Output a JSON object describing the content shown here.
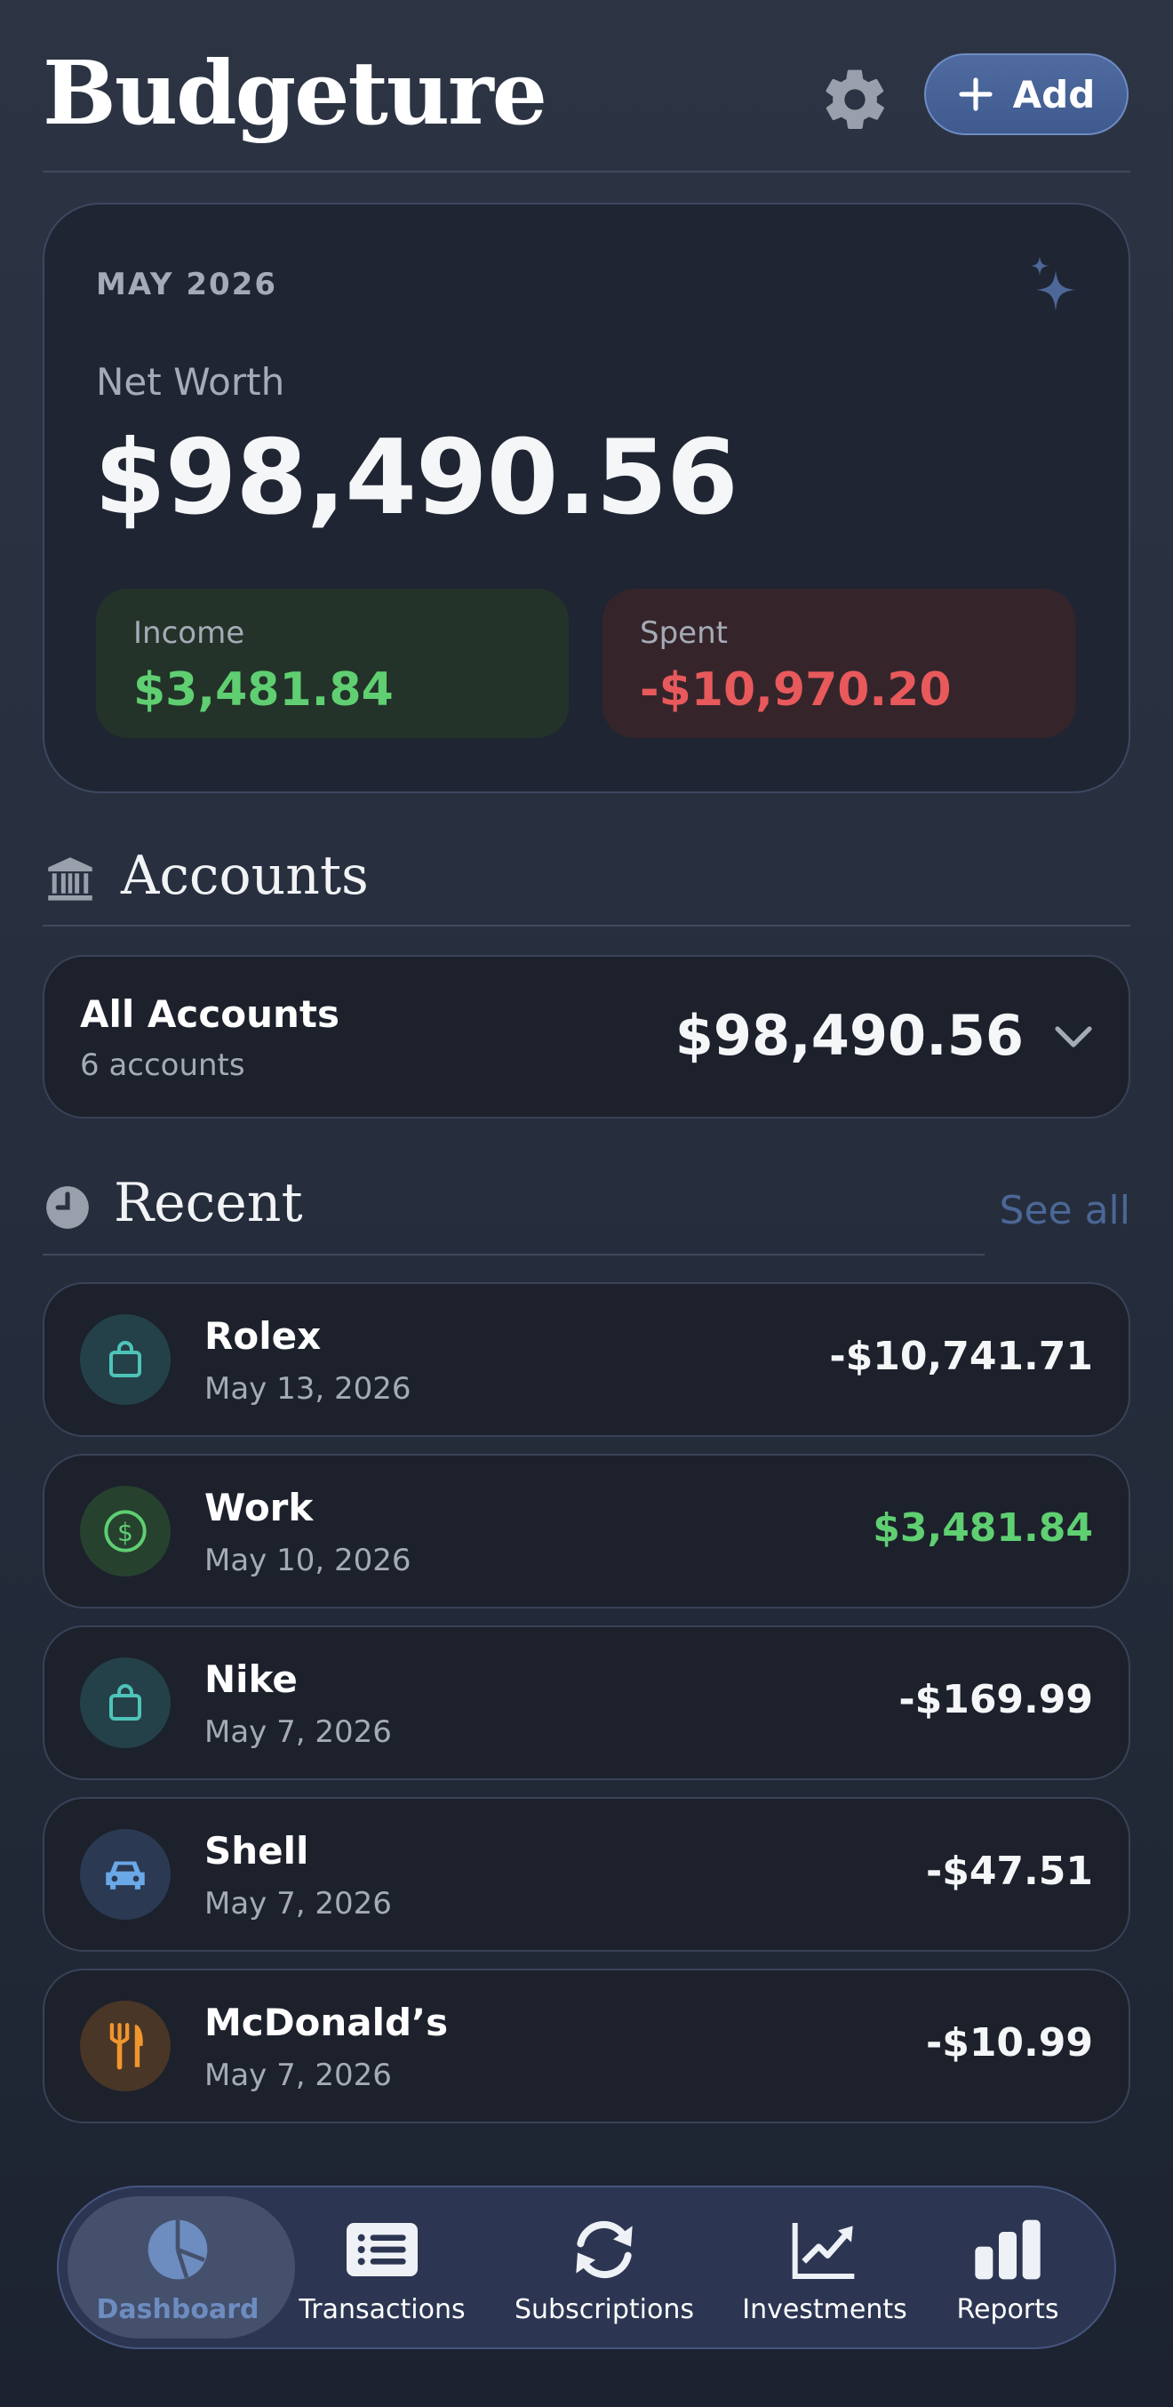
{
  "header": {
    "title": "Budgeture",
    "add_label": "Add"
  },
  "summary": {
    "month": "MAY 2026",
    "net_worth_label": "Net Worth",
    "net_worth_value": "$98,490.56",
    "income_label": "Income",
    "income_value": "$3,481.84",
    "spent_label": "Spent",
    "spent_value": "-$10,970.20"
  },
  "accounts": {
    "section_title": "Accounts",
    "card_title": "All Accounts",
    "card_subtitle": "6 accounts",
    "total": "$98,490.56"
  },
  "recent": {
    "section_title": "Recent",
    "see_all": "See all",
    "transactions": [
      {
        "name": "Rolex",
        "date": "May 13, 2026",
        "amount": "-$10,741.71",
        "icon": "shopping-bag-icon"
      },
      {
        "name": "Work",
        "date": "May 10, 2026",
        "amount": "$3,481.84",
        "icon": "dollar-circle-icon"
      },
      {
        "name": "Nike",
        "date": "May 7, 2026",
        "amount": "-$169.99",
        "icon": "shopping-bag-icon"
      },
      {
        "name": "Shell",
        "date": "May 7, 2026",
        "amount": "-$47.51",
        "icon": "car-icon"
      },
      {
        "name": "McDonald’s",
        "date": "May 7, 2026",
        "amount": "-$10.99",
        "icon": "fork-knife-icon"
      }
    ]
  },
  "nav": {
    "items": [
      {
        "label": "Dashboard",
        "icon": "pie-chart-icon",
        "active": true
      },
      {
        "label": "Transactions",
        "icon": "list-icon"
      },
      {
        "label": "Subscriptions",
        "icon": "refresh-icon"
      },
      {
        "label": "Investments",
        "icon": "line-chart-icon"
      },
      {
        "label": "Reports",
        "icon": "bar-chart-icon"
      }
    ]
  },
  "colors": {
    "accent": "#4f6ba0",
    "income_green": "#5fcf72",
    "spent_red": "#e8595c",
    "muted_text": "#a5abb6",
    "nav_active_text": "#6d8cc0"
  }
}
